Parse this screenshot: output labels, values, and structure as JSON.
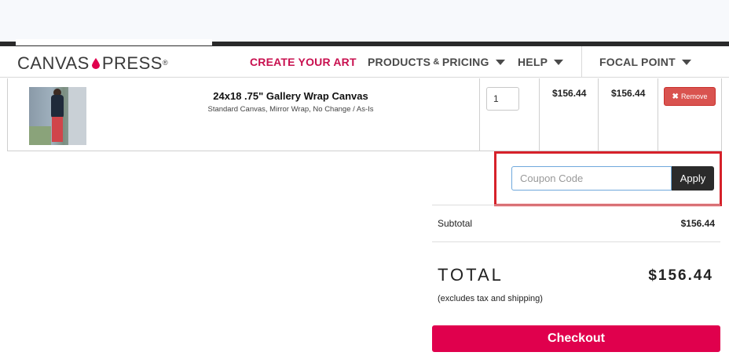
{
  "header": {
    "logo_left": "CANVAS",
    "logo_right": "PRESS",
    "logo_mark": "®",
    "nav": {
      "create": "CREATE YOUR ART",
      "products_main": "PRODUCTS",
      "products_amp": " & ",
      "products_tail": "PRICING",
      "help": "HELP",
      "focal": "FOCAL POINT"
    }
  },
  "cart": {
    "item": {
      "title": "24x18 .75\" Gallery Wrap Canvas",
      "description": "Standard Canvas, Mirror Wrap, No Change / As-Is",
      "quantity": "1",
      "unit_price": "$156.44",
      "line_total": "$156.44",
      "remove_label": "Remove"
    }
  },
  "coupon": {
    "placeholder": "Coupon Code",
    "apply_label": "Apply"
  },
  "summary": {
    "subtotal_label": "Subtotal",
    "subtotal_value": "$156.44",
    "total_label": "TOTAL",
    "total_value": "$156.44",
    "total_note": "(excludes tax and shipping)",
    "checkout_label": "Checkout"
  },
  "colors": {
    "brand": "#e0004d",
    "nav_active": "#c8104f",
    "remove": "#d9534f",
    "highlight": "#d6212a"
  }
}
